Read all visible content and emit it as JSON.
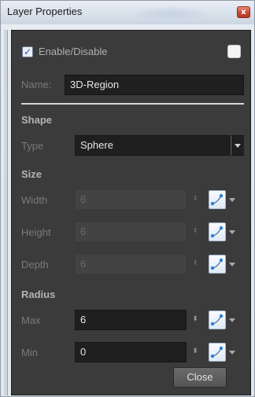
{
  "window": {
    "title": "Layer Properties",
    "close_glyph": "x"
  },
  "enable": {
    "checked": true,
    "check_glyph": "✓",
    "label": "Enable/Disable"
  },
  "name": {
    "label": "Name:",
    "value": "3D-Region"
  },
  "shape": {
    "heading": "Shape",
    "type_label": "Type",
    "type_value": "Sphere"
  },
  "size": {
    "heading": "Size",
    "fields": [
      {
        "label": "Width",
        "value": "6",
        "enabled": false
      },
      {
        "label": "Height",
        "value": "6",
        "enabled": false
      },
      {
        "label": "Depth",
        "value": "6",
        "enabled": false
      }
    ]
  },
  "radius": {
    "heading": "Radius",
    "fields": [
      {
        "label": "Max",
        "value": "6",
        "enabled": true
      },
      {
        "label": "Min",
        "value": "0",
        "enabled": true
      }
    ]
  },
  "spin_glyph": "⬍",
  "close_button": "Close",
  "colors": {
    "panel": "#3b3b3b",
    "field": "#1f1f1f",
    "accent": "#2a7fd4",
    "checkbox": "#2a58c8"
  },
  "icons": [
    "close-icon",
    "checkbox-check-icon",
    "dropdown-arrow-icon",
    "function-curve-icon",
    "spinner-icon"
  ]
}
